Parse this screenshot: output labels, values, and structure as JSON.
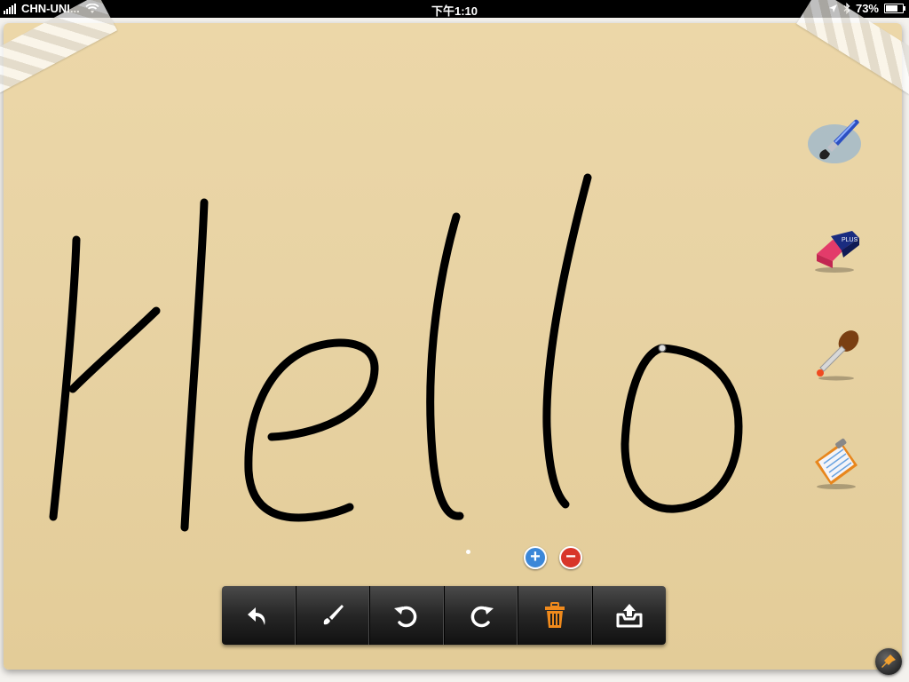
{
  "status_bar": {
    "carrier": "CHN-UNI...",
    "time": "下午1:10",
    "battery": "73%",
    "battery_level": 0.73
  },
  "canvas": {
    "drawn_text": "Hello",
    "ink_color": "#000000",
    "paper_color": "#e8d3a4"
  },
  "tools": [
    {
      "name": "brush-tool",
      "icon": "paintbrush-icon",
      "active": true
    },
    {
      "name": "eraser-tool",
      "icon": "eraser-icon",
      "active": false
    },
    {
      "name": "color-picker-tool",
      "icon": "eyedropper-icon",
      "active": false
    },
    {
      "name": "notepad-tool",
      "icon": "clipboard-icon",
      "active": false
    }
  ],
  "zoom": {
    "in_label": "+",
    "out_label": "−"
  },
  "toolbar": {
    "buttons": [
      {
        "name": "back",
        "icon": "back-arrow-icon"
      },
      {
        "name": "brush",
        "icon": "brush-icon"
      },
      {
        "name": "undo",
        "icon": "undo-icon"
      },
      {
        "name": "redo",
        "icon": "redo-icon"
      },
      {
        "name": "delete",
        "icon": "trash-icon",
        "color": "#f08a1c"
      },
      {
        "name": "share",
        "icon": "share-tray-icon"
      }
    ]
  },
  "colors": {
    "accent_blue": "#3b87d8",
    "accent_red": "#d8352a",
    "trash_orange": "#f08a1c"
  }
}
